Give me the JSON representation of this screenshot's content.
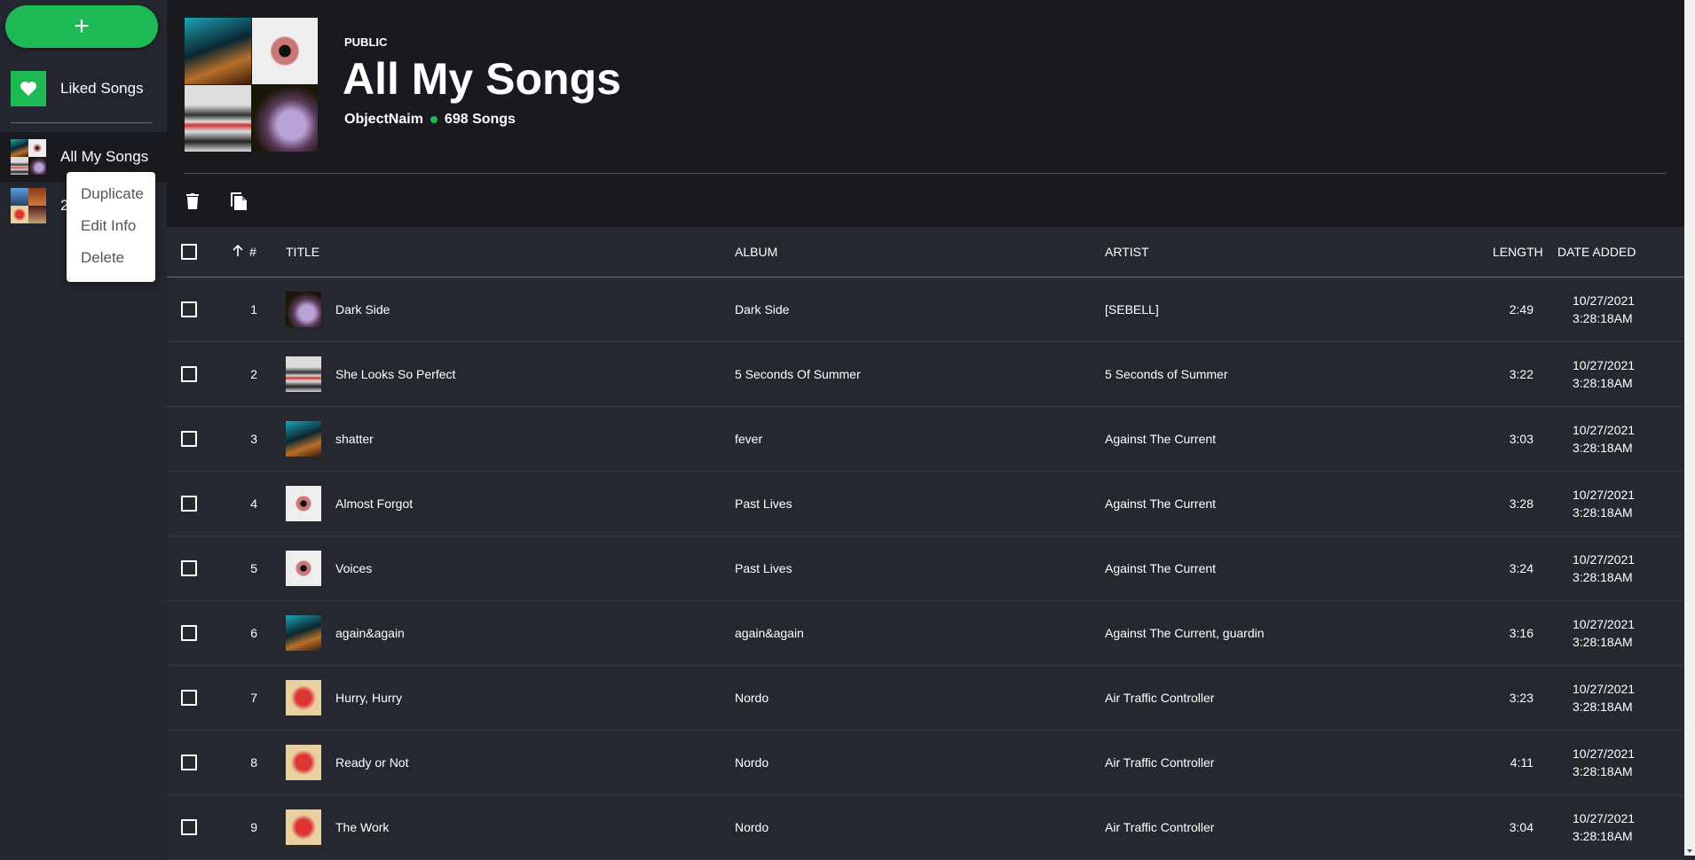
{
  "sidebar": {
    "add_label": "+",
    "liked_label": "Liked Songs",
    "playlists": [
      {
        "label": "All My Songs",
        "active": true
      },
      {
        "label": "2",
        "active": false
      }
    ],
    "context_menu": [
      "Duplicate",
      "Edit Info",
      "Delete"
    ]
  },
  "header": {
    "visibility": "PUBLIC",
    "title": "All My Songs",
    "owner": "ObjectNaim",
    "count": "698 Songs"
  },
  "toolbar": {
    "icons": [
      "trash-icon",
      "copy-icon"
    ]
  },
  "columns": {
    "num": "#",
    "title": "TITLE",
    "album": "ALBUM",
    "artist": "ARTIST",
    "length": "LENGTH",
    "date": "DATE ADDED"
  },
  "rows": [
    {
      "num": "1",
      "title": "Dark Side",
      "album": "Dark Side",
      "artist": "[SEBELL]",
      "length": "2:49",
      "date": "10/27/2021",
      "time": "3:28:18AM",
      "art": "c4"
    },
    {
      "num": "2",
      "title": "She Looks So Perfect",
      "album": "5 Seconds Of Summer",
      "artist": "5 Seconds of Summer",
      "length": "3:22",
      "date": "10/27/2021",
      "time": "3:28:18AM",
      "art": "c3"
    },
    {
      "num": "3",
      "title": "shatter",
      "album": "fever",
      "artist": "Against The Current",
      "length": "3:03",
      "date": "10/27/2021",
      "time": "3:28:18AM",
      "art": "c1"
    },
    {
      "num": "4",
      "title": "Almost Forgot",
      "album": "Past Lives",
      "artist": "Against The Current",
      "length": "3:28",
      "date": "10/27/2021",
      "time": "3:28:18AM",
      "art": "c2"
    },
    {
      "num": "5",
      "title": "Voices",
      "album": "Past Lives",
      "artist": "Against The Current",
      "length": "3:24",
      "date": "10/27/2021",
      "time": "3:28:18AM",
      "art": "c2"
    },
    {
      "num": "6",
      "title": "again&again",
      "album": "again&again",
      "artist": "Against The Current, guardin",
      "length": "3:16",
      "date": "10/27/2021",
      "time": "3:28:18AM",
      "art": "c1"
    },
    {
      "num": "7",
      "title": "Hurry, Hurry",
      "album": "Nordo",
      "artist": "Air Traffic Controller",
      "length": "3:23",
      "date": "10/27/2021",
      "time": "3:28:18AM",
      "art": "c7"
    },
    {
      "num": "8",
      "title": "Ready or Not",
      "album": "Nordo",
      "artist": "Air Traffic Controller",
      "length": "4:11",
      "date": "10/27/2021",
      "time": "3:28:18AM",
      "art": "c7"
    },
    {
      "num": "9",
      "title": "The Work",
      "album": "Nordo",
      "artist": "Air Traffic Controller",
      "length": "3:04",
      "date": "10/27/2021",
      "time": "3:28:18AM",
      "art": "c7"
    }
  ],
  "colors": {
    "accent": "#1db954",
    "header_bg": "#181a1f",
    "table_bg": "#262830",
    "sidebar_bg": "#23262e"
  }
}
